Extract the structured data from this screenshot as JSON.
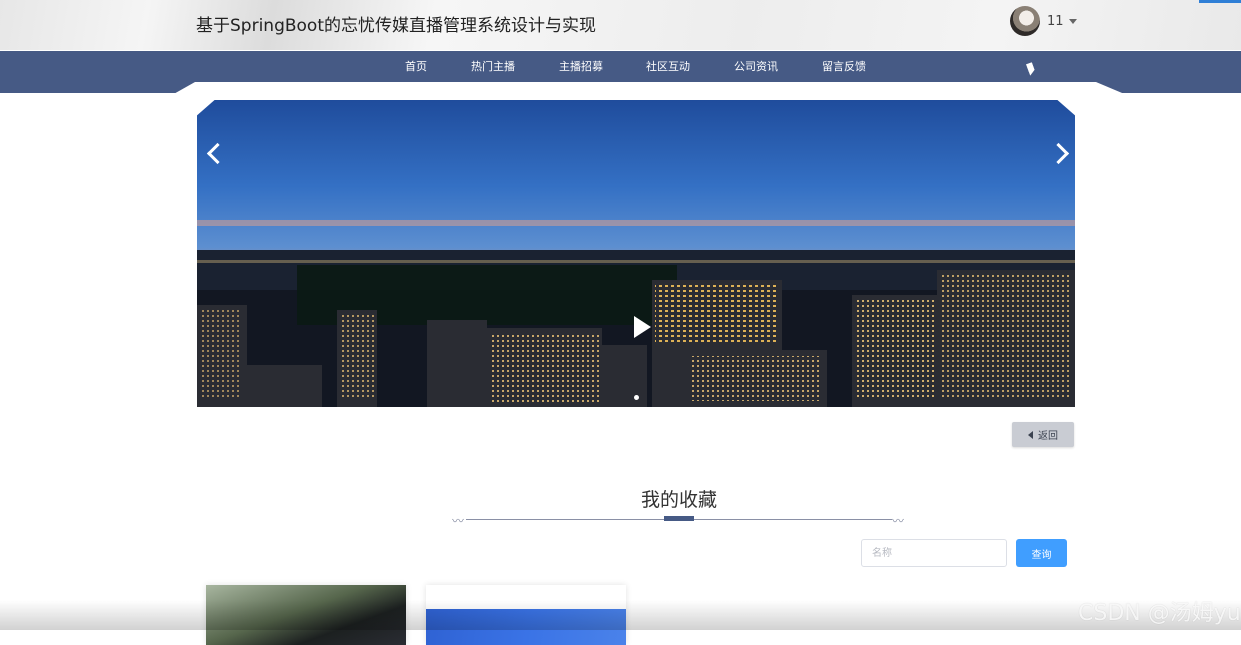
{
  "header": {
    "title": "基于SpringBoot的忘忧传媒直播管理系统设计与实现",
    "username": "11",
    "avatar_icon": "avatar",
    "dropdown_icon": "caret-down-icon"
  },
  "nav": {
    "items": [
      {
        "label": "首页"
      },
      {
        "label": "热门主播"
      },
      {
        "label": "主播招募"
      },
      {
        "label": "社区互动"
      },
      {
        "label": "公司资讯"
      },
      {
        "label": "留言反馈"
      }
    ]
  },
  "banner": {
    "prev_icon": "chevron-left-icon",
    "next_icon": "chevron-right-icon",
    "play_icon": "play-icon",
    "slide_count": 1
  },
  "actions": {
    "back_label": "返回"
  },
  "section": {
    "title": "我的收藏"
  },
  "search": {
    "placeholder": "名称",
    "value": "",
    "button_label": "查询"
  },
  "watermark": {
    "text": "CSDN @汤姆yu"
  },
  "colors": {
    "nav_bg": "#465a85",
    "search_button": "#409eff",
    "back_button": "#c9ccd3"
  }
}
